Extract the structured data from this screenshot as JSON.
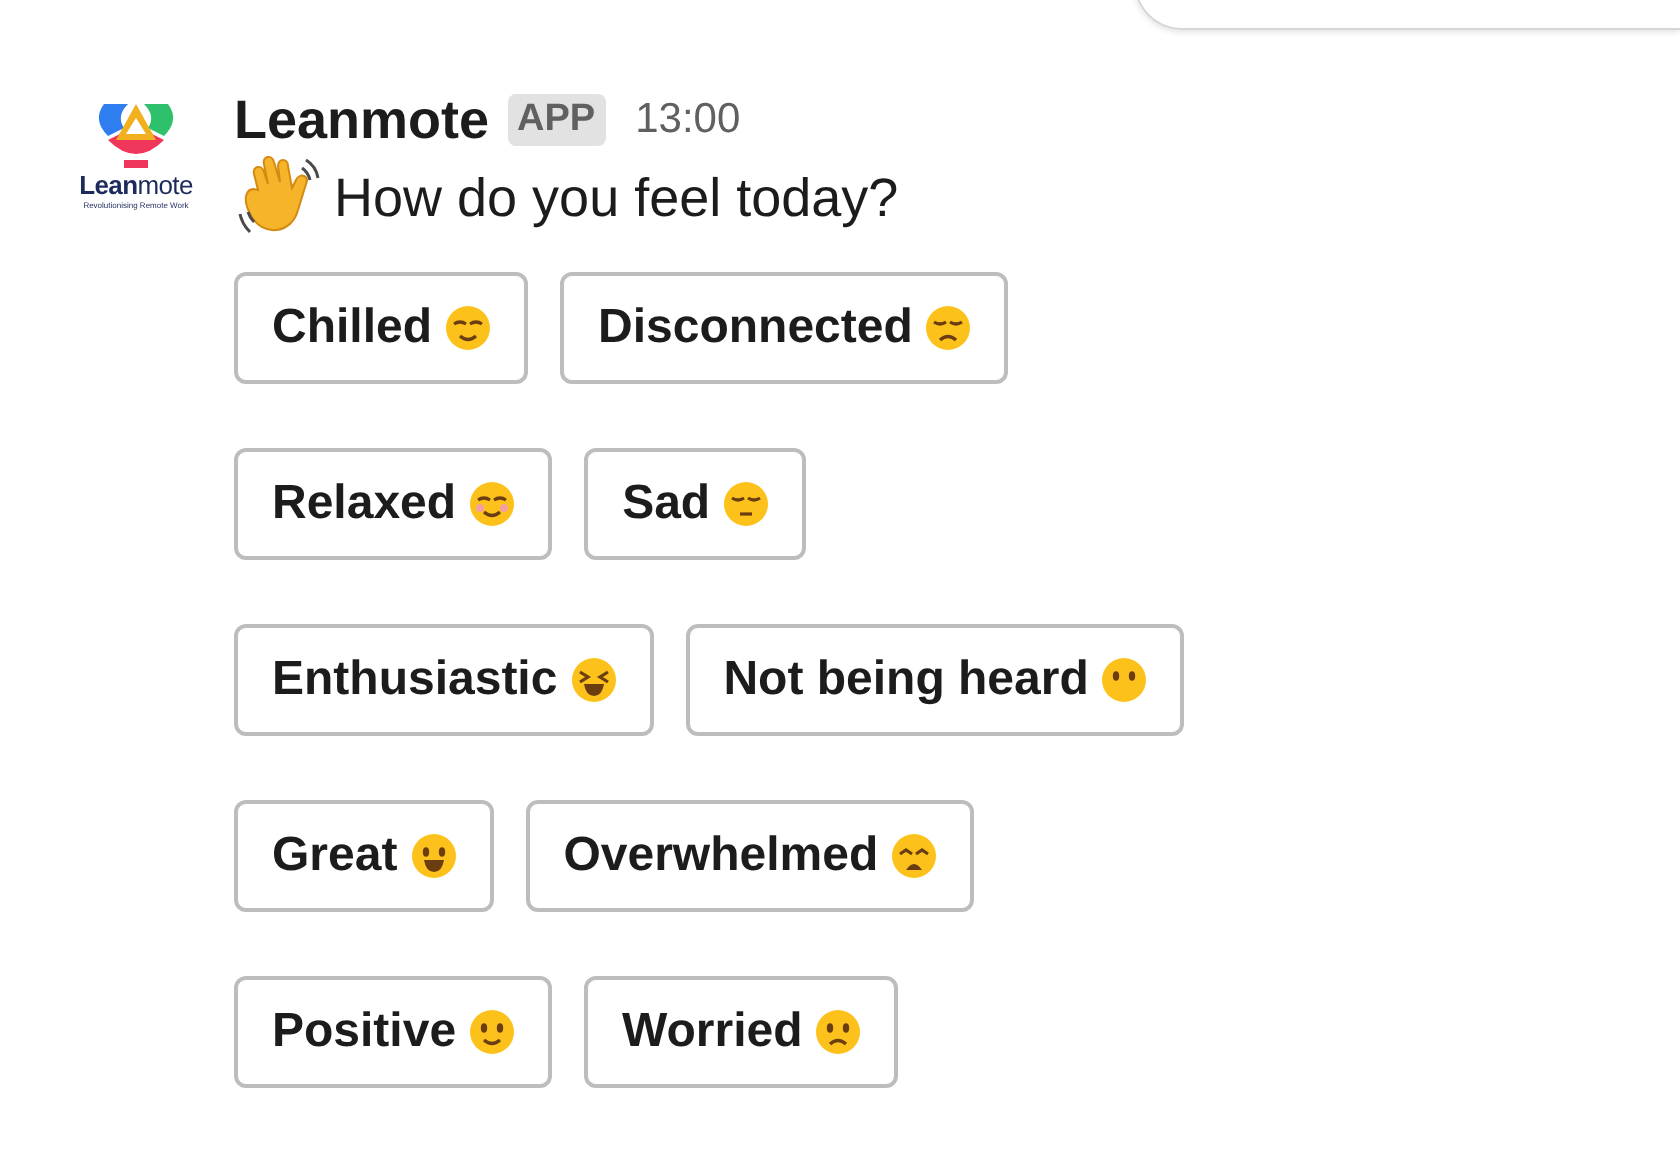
{
  "message": {
    "sender": "Leanmote",
    "badge": "APP",
    "time": "13:00",
    "logo_tagline": "Revolutionising Remote Work",
    "logo_name_bold": "Lean",
    "logo_name_light": "mote",
    "text": "How do you feel today?"
  },
  "rows": [
    [
      {
        "label": "Chilled",
        "kind": "relieved"
      },
      {
        "label": "Disconnected",
        "kind": "disappointed"
      }
    ],
    [
      {
        "label": "Relaxed",
        "kind": "blush"
      },
      {
        "label": "Sad",
        "kind": "unamused"
      }
    ],
    [
      {
        "label": "Enthusiastic",
        "kind": "laughing"
      },
      {
        "label": "Not being heard",
        "kind": "nomouth"
      }
    ],
    [
      {
        "label": "Great",
        "kind": "grin"
      },
      {
        "label": "Overwhelmed",
        "kind": "weary"
      }
    ],
    [
      {
        "label": "Positive",
        "kind": "smile"
      },
      {
        "label": "Worried",
        "kind": "worried"
      }
    ]
  ]
}
